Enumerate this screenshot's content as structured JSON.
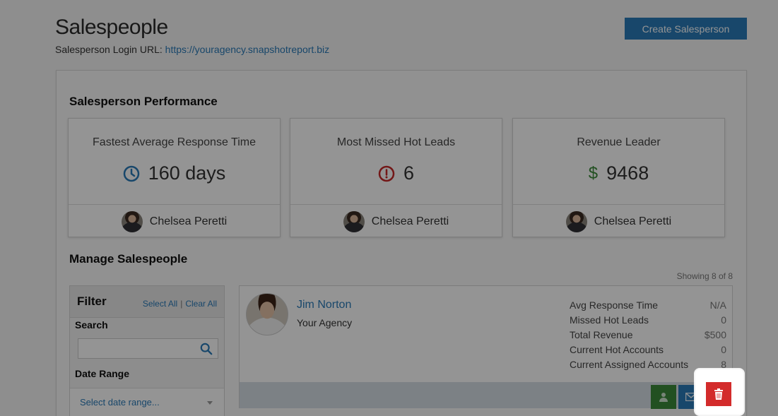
{
  "header": {
    "title": "Salespeople",
    "login_label": "Salesperson Login URL:",
    "login_url": "https://youragency.snapshotreport.biz",
    "create_button": "Create Salesperson"
  },
  "performance": {
    "heading": "Salesperson Performance",
    "cards": [
      {
        "title": "Fastest Average Response Time",
        "value": "160 days",
        "icon": "clock-icon",
        "icon_color": "#2a7ab8",
        "person": "Chelsea Peretti"
      },
      {
        "title": "Most Missed Hot Leads",
        "value": "6",
        "icon": "alert-icon",
        "icon_color": "#c62828",
        "person": "Chelsea Peretti"
      },
      {
        "title": "Revenue Leader",
        "value": "9468",
        "icon": "dollar-icon",
        "icon_color": "#3b8a3a",
        "person": "Chelsea Peretti"
      }
    ]
  },
  "manage": {
    "heading": "Manage Salespeople",
    "showing": "Showing 8 of 8"
  },
  "filter": {
    "heading": "Filter",
    "select_all": "Select All",
    "separator": "|",
    "clear_all": "Clear All",
    "search_label": "Search",
    "search_value": "",
    "date_label": "Date Range",
    "date_placeholder": "Select date range..."
  },
  "salesperson": {
    "name": "Jim Norton",
    "org": "Your Agency",
    "stats": [
      {
        "label": "Avg Response Time",
        "value": "N/A"
      },
      {
        "label": "Missed Hot Leads",
        "value": "0"
      },
      {
        "label": "Total Revenue",
        "value": "$500"
      },
      {
        "label": "Current Hot Accounts",
        "value": "0"
      },
      {
        "label": "Current Assigned Accounts",
        "value": "8"
      }
    ],
    "actions": [
      "user-icon",
      "mail-icon",
      "trash-icon"
    ]
  },
  "colors": {
    "accent": "#2a7ab8",
    "success": "#3b8a3a",
    "danger": "#d32b2b"
  }
}
